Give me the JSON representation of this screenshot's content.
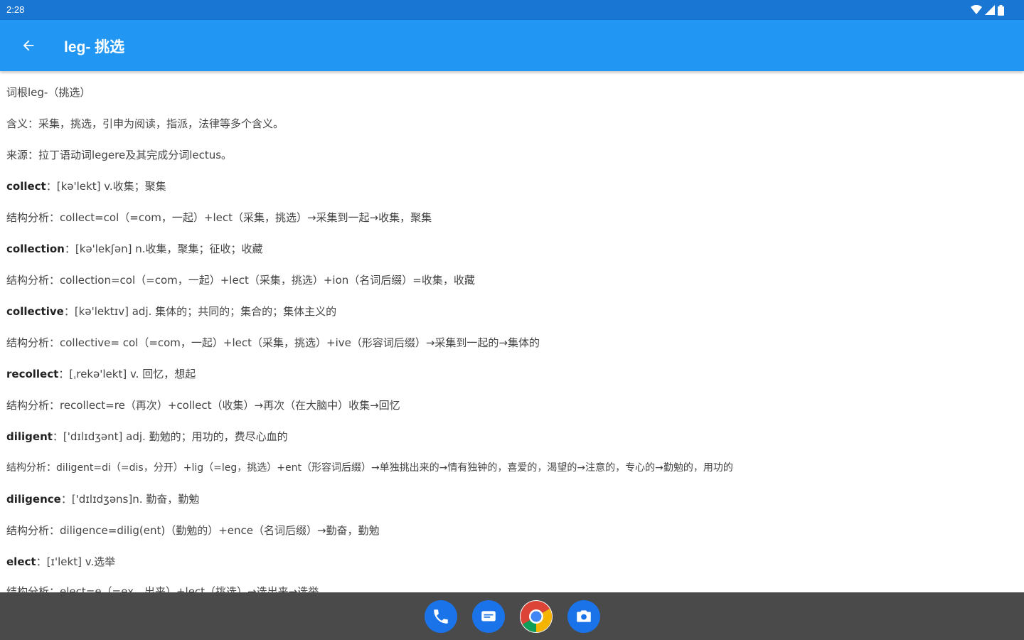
{
  "status_bar": {
    "time": "2:28"
  },
  "app_bar": {
    "title": "leg- 挑选"
  },
  "content": {
    "lines": [
      {
        "word": "",
        "text": "词根leg-（挑选）"
      },
      {
        "word": "",
        "text": "含义：采集，挑选，引申为阅读，指派，法律等多个含义。"
      },
      {
        "word": "",
        "text": "来源：拉丁语动词legere及其完成分词lectus。"
      },
      {
        "word": "collect",
        "text": "：[kə'lekt] v.收集；聚集"
      },
      {
        "word": "",
        "text": "结构分析：collect=col（=com，一起）+lect（采集，挑选）→采集到一起→收集，聚集"
      },
      {
        "word": "collection",
        "text": "：[kə'lekʃən] n.收集，聚集；征收；收藏"
      },
      {
        "word": "",
        "text": "结构分析：collection=col（=com，一起）+lect（采集，挑选）+ion（名词后缀）=收集，收藏"
      },
      {
        "word": "collective",
        "text": "：[kə'lektɪv] adj. 集体的；共同的；集合的；集体主义的"
      },
      {
        "word": "",
        "text": "结构分析：collective= col（=com，一起）+lect（采集，挑选）+ive（形容词后缀）→采集到一起的→集体的"
      },
      {
        "word": "recollect",
        "text": "：[ˌrekə'lekt] v. 回忆，想起"
      },
      {
        "word": "",
        "text": "结构分析：recollect=re（再次）+collect（收集）→再次（在大脑中）收集→回忆"
      },
      {
        "word": "diligent",
        "text": "：['dɪlɪdʒənt] adj. 勤勉的；用功的，费尽心血的"
      },
      {
        "word": "",
        "text": "结构分析：diligent=di（=dis，分开）+lig（=leg，挑选）+ent（形容词后缀）→单独挑出来的→情有独钟的，喜爱的，渴望的→注意的，专心的→勤勉的，用功的"
      },
      {
        "word": "diligence",
        "text": "：['dɪlɪdʒəns]n. 勤奋，勤勉"
      },
      {
        "word": "",
        "text": "结构分析：diligence=dilig(ent)（勤勉的）+ence（名词后缀）→勤奋，勤勉"
      },
      {
        "word": "elect",
        "text": "：[ɪ'lekt] v.选举"
      },
      {
        "word": "",
        "text": "结构分析：elect=e（=ex，出来）+lect（挑选）→选出来→选举"
      }
    ]
  },
  "dock": [
    {
      "name": "phone",
      "color": "#1a73e8"
    },
    {
      "name": "messages",
      "color": "#1a73e8"
    },
    {
      "name": "chrome",
      "color": "#ffffff"
    },
    {
      "name": "camera",
      "color": "#1a73e8"
    }
  ]
}
